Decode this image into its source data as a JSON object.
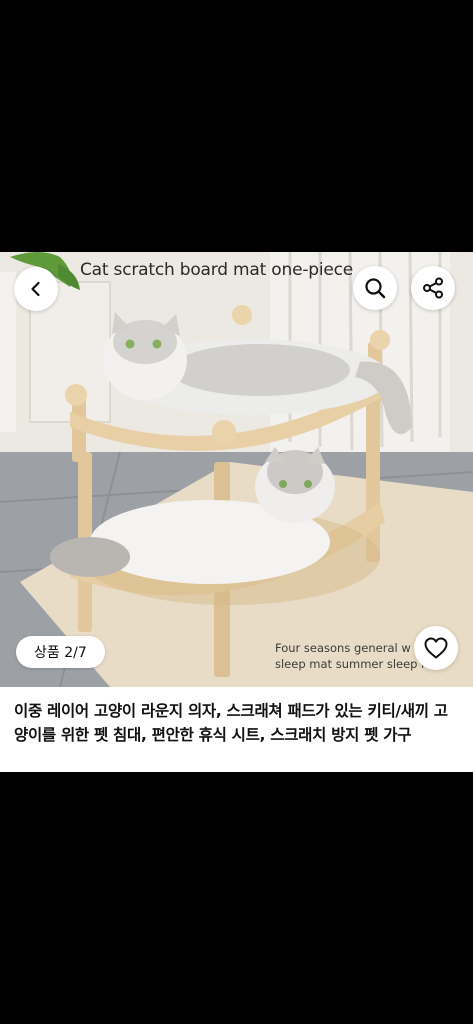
{
  "image": {
    "overlay_text_top": "Cat scratch board mat one-piece",
    "overlay_text_bottom_line1": "Four seasons general w",
    "overlay_text_bottom_line2": "sleep mat summer sleep mat"
  },
  "nav": {
    "back_icon": "chevron-left-icon",
    "search_icon": "search-icon",
    "share_icon": "share-icon"
  },
  "gallery": {
    "counter": "상품 2/7",
    "favorite_icon": "heart-icon"
  },
  "product": {
    "title": "이중 레이어 고양이 라운지 의자, 스크래쳐 패드가 있는 키티/새끼 고양이를 위한 펫 침대, 편안한 휴식 시트, 스크래치 방지 펫 가구"
  }
}
